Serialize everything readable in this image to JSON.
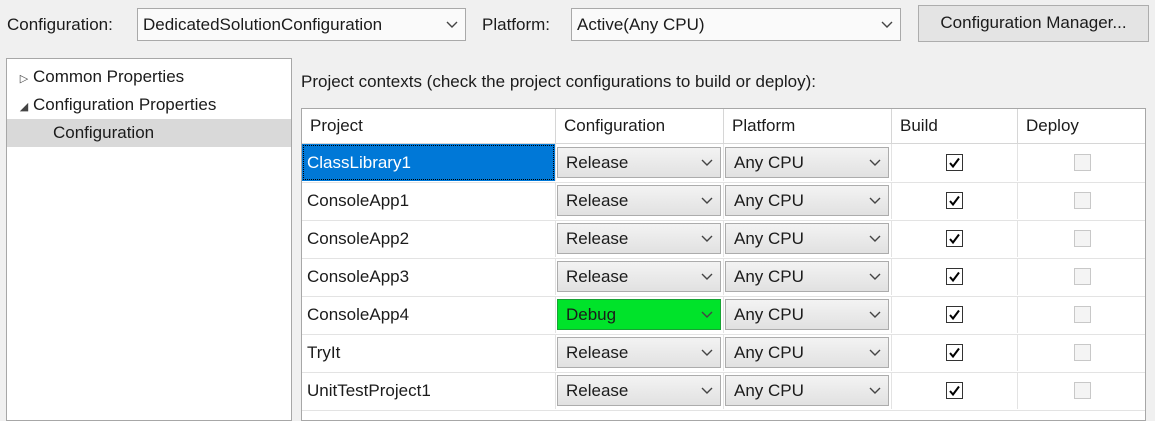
{
  "toolbar": {
    "configuration_label": "Configuration:",
    "configuration_value": "DedicatedSolutionConfiguration",
    "platform_label": "Platform:",
    "platform_value": "Active(Any CPU)",
    "config_manager_button": "Configuration Manager..."
  },
  "tree": {
    "items": [
      {
        "label": "Common Properties",
        "expanded": false
      },
      {
        "label": "Configuration Properties",
        "expanded": true
      },
      {
        "label": "Configuration",
        "selected": true
      }
    ]
  },
  "main": {
    "description": "Project contexts (check the project configurations to build or deploy):",
    "columns": [
      "Project",
      "Configuration",
      "Platform",
      "Build",
      "Deploy"
    ],
    "rows": [
      {
        "project": "ClassLibrary1",
        "configuration": "Release",
        "platform": "Any CPU",
        "build": true,
        "deploy": false,
        "selected": true
      },
      {
        "project": "ConsoleApp1",
        "configuration": "Release",
        "platform": "Any CPU",
        "build": true,
        "deploy": false
      },
      {
        "project": "ConsoleApp2",
        "configuration": "Release",
        "platform": "Any CPU",
        "build": true,
        "deploy": false
      },
      {
        "project": "ConsoleApp3",
        "configuration": "Release",
        "platform": "Any CPU",
        "build": true,
        "deploy": false
      },
      {
        "project": "ConsoleApp4",
        "configuration": "Debug",
        "platform": "Any CPU",
        "build": true,
        "deploy": false,
        "highlighted": true
      },
      {
        "project": "TryIt",
        "configuration": "Release",
        "platform": "Any CPU",
        "build": true,
        "deploy": false
      },
      {
        "project": "UnitTestProject1",
        "configuration": "Release",
        "platform": "Any CPU",
        "build": true,
        "deploy": false
      }
    ]
  },
  "colors": {
    "selection": "#0078d7",
    "highlight_combo": "#00e32a",
    "tree_selection": "#d9d9d9"
  }
}
